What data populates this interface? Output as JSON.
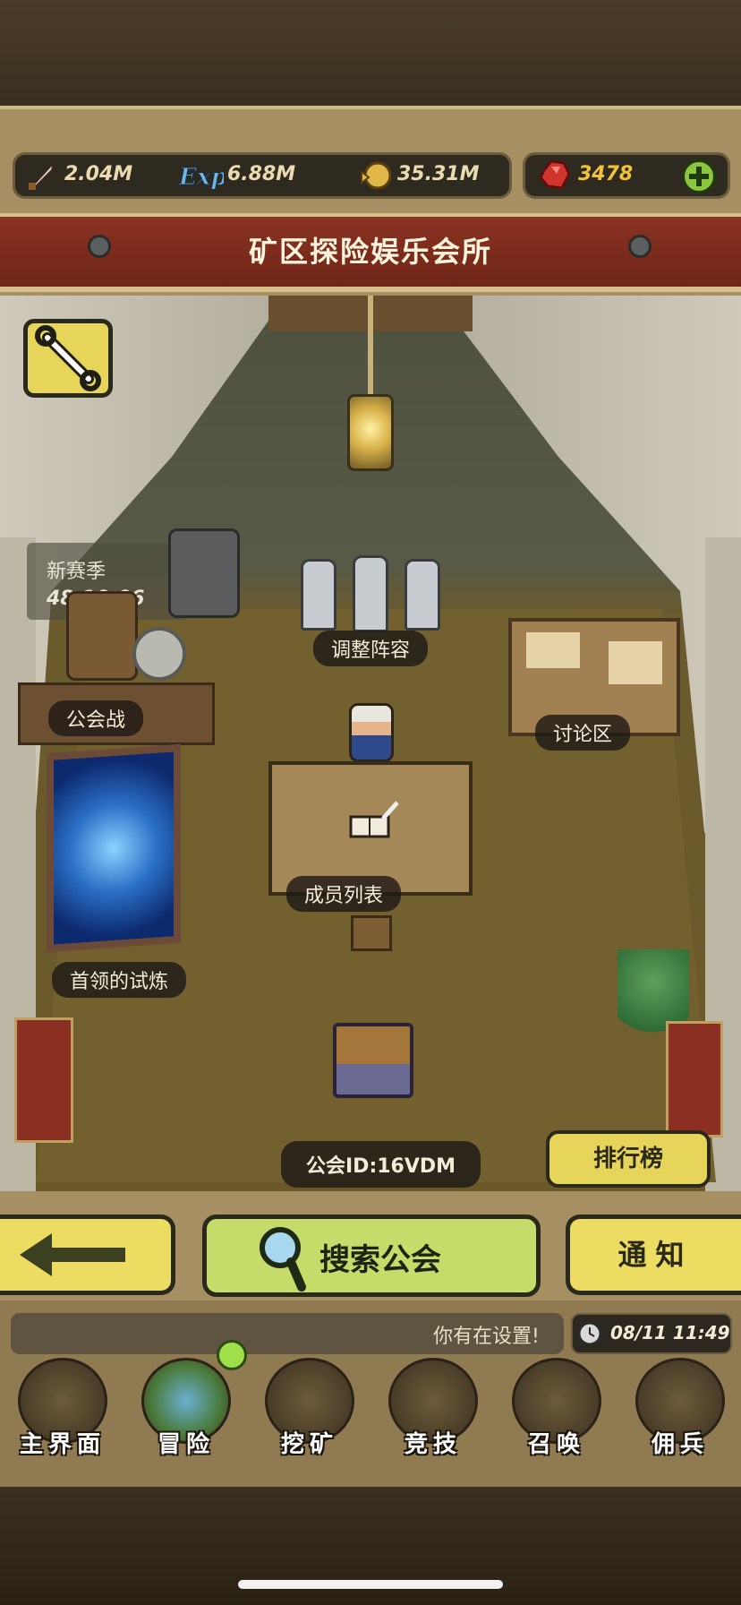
{
  "resources": {
    "attack": {
      "icon": "sword-icon",
      "value": "2.04M"
    },
    "exp": {
      "icon": "exp-icon",
      "value": "6.88M"
    },
    "gold": {
      "icon": "gold-coin-icon",
      "value": "35.31M"
    },
    "gems": {
      "icon": "ruby-icon",
      "value": "3478"
    }
  },
  "title": "矿区探险娱乐会所",
  "season": {
    "label": "新赛季",
    "countdown": "48:10:06"
  },
  "room_labels": {
    "guild_war": "公会战",
    "adjust_lineup": "调整阵容",
    "discussion": "讨论区",
    "member_list": "成员列表",
    "boss_trial": "首领的试炼",
    "guild_id": "公会ID:16VDM",
    "ranking": "排行榜"
  },
  "actions": {
    "back_icon": "arrow-left-icon",
    "search_label": "搜索公会",
    "notice_label": "通知"
  },
  "status": {
    "message": "你有在设置!",
    "datetime": "08/11 11:49"
  },
  "nav": [
    {
      "label": "主界面",
      "icon": "map-scroll-icon"
    },
    {
      "label": "冒险",
      "icon": "island-icon"
    },
    {
      "label": "挖矿",
      "icon": "pickaxe-icon"
    },
    {
      "label": "竞技",
      "icon": "crossed-swords-icon"
    },
    {
      "label": "召唤",
      "icon": "scroll-icon"
    },
    {
      "label": "佣兵",
      "icon": "tent-icon"
    }
  ],
  "colors": {
    "banner": "#7a2a1b",
    "button_yellow": "#ecdc62",
    "button_green": "#c6dc6a",
    "gem_text": "#f2c23a"
  }
}
